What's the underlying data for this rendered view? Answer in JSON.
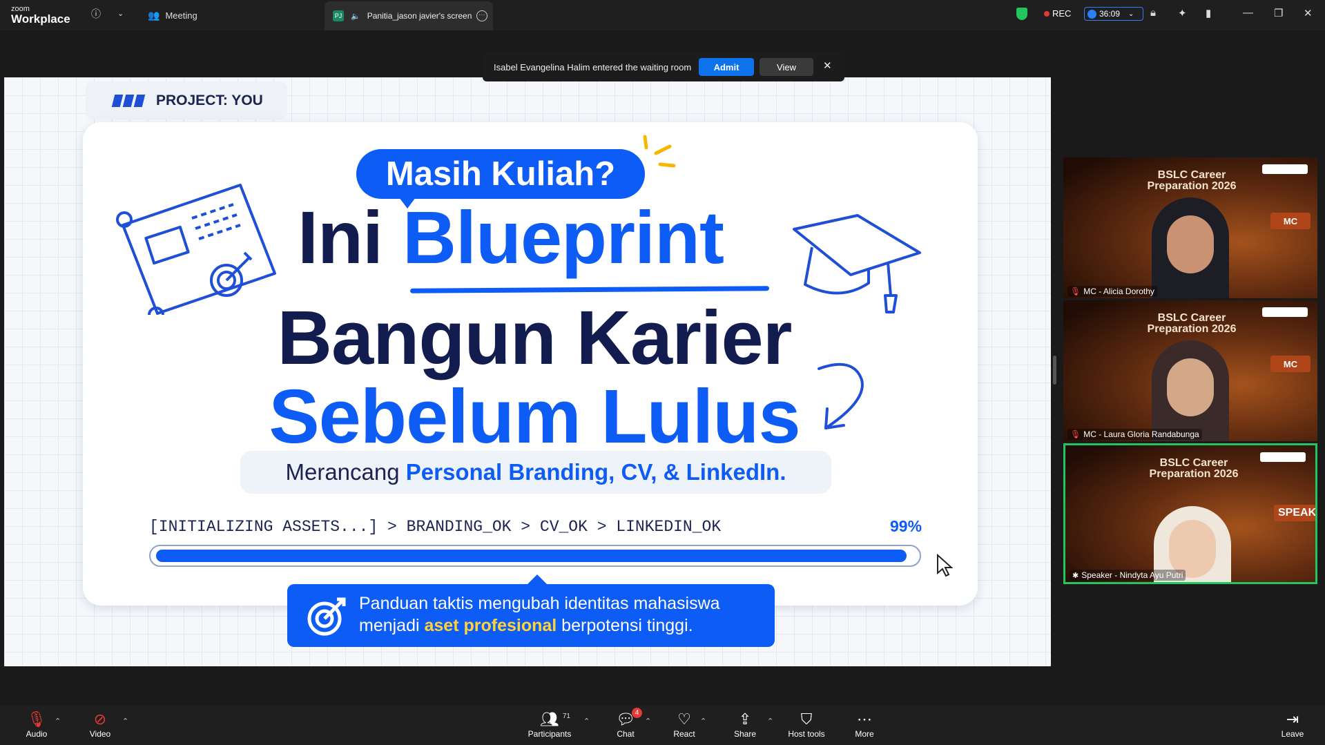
{
  "app": {
    "logo_small": "zoom",
    "logo_big": "Workplace",
    "tab_meeting": "Meeting",
    "tab_screen": "Panitia_jason javier's screen",
    "rec_label": "REC",
    "timer": "36:09"
  },
  "notification": {
    "message": "Isabel Evangelina Halim entered the waiting room",
    "admit_label": "Admit",
    "view_label": "View"
  },
  "slide": {
    "project_label": "PROJECT: YOU",
    "bubble": "Masih Kuliah?",
    "line1_a": "Ini ",
    "line1_b": "Blueprint",
    "line2": "Bangun Karier",
    "line3": "Sebelum Lulus",
    "sub_a": "Merancang ",
    "sub_b": "Personal Branding, CV, & LinkedIn.",
    "status": "[INITIALIZING ASSETS...] > BRANDING_OK > CV_OK > LINKEDIN_OK",
    "percent": "99%",
    "progress": 0.99,
    "callout_1": "Panduan taktis mengubah identitas mahasiswa",
    "callout_2a": "menjadi ",
    "callout_2b": "aset profesional",
    "callout_2c": " berpotensi tinggi."
  },
  "participants": [
    {
      "title": "BSLC Career\nPreparation 2026",
      "badge": "MC",
      "name": "MC - Alicia Dorothy"
    },
    {
      "title": "BSLC Career\nPreparation 2026",
      "badge": "MC",
      "name": "MC - Laura Gloria Randabunga"
    },
    {
      "title": "BSLC Career\nPreparation 2026",
      "badge": "SPEAKE",
      "name": "Speaker - Nindyta Ayu Putri"
    }
  ],
  "toolbar": {
    "audio": "Audio",
    "video": "Video",
    "participants": "Participants",
    "participants_count": "71",
    "chat": "Chat",
    "chat_badge": "4",
    "react": "React",
    "share": "Share",
    "host_tools": "Host tools",
    "more": "More",
    "leave": "Leave"
  },
  "colors": {
    "accent": "#0d5cf5",
    "navy": "#131c4e",
    "active_speaker": "#22c55e",
    "admit": "#0e72ed"
  },
  "icons": [
    "info-icon",
    "chevron-down-icon",
    "participants-icon",
    "speaker-icon",
    "more-icon",
    "shield-icon",
    "record-icon",
    "clock-icon",
    "lock-icon",
    "sparkle-icon",
    "exit-icon",
    "minimize-icon",
    "restore-icon",
    "close-icon",
    "mic-off-icon",
    "video-off-icon",
    "chat-icon",
    "heart-icon",
    "share-icon",
    "host-shield-icon",
    "leave-icon"
  ]
}
